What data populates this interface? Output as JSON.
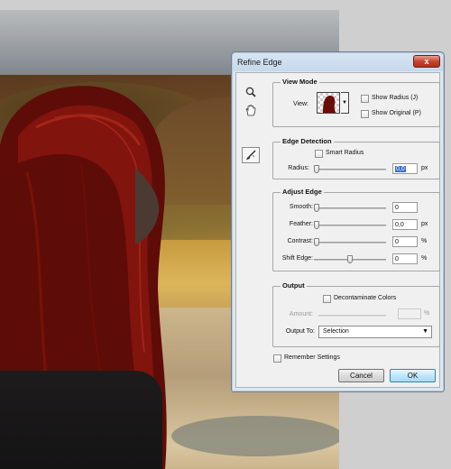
{
  "dialog": {
    "title": "Refine Edge",
    "close_symbol": "x",
    "tools": [
      "zoom-icon",
      "hand-icon",
      "refine-radius-brush-icon"
    ],
    "view_mode": {
      "heading": "View Mode",
      "view_label": "View:",
      "show_radius_label": "Show Radius (J)",
      "show_original_label": "Show Original (P)"
    },
    "edge_detection": {
      "heading": "Edge Detection",
      "smart_radius_label": "Smart Radius",
      "radius_label": "Radius:",
      "radius_value": "0,0",
      "radius_unit": "px"
    },
    "adjust_edge": {
      "heading": "Adjust Edge",
      "smooth_label": "Smooth:",
      "smooth_value": "0",
      "feather_label": "Feather:",
      "feather_value": "0,0",
      "feather_unit": "px",
      "contrast_label": "Contrast:",
      "contrast_value": "0",
      "contrast_unit": "%",
      "shift_edge_label": "Shift Edge:",
      "shift_edge_value": "0",
      "shift_edge_unit": "%"
    },
    "output": {
      "heading": "Output",
      "decontaminate_label": "Decontaminate Colors",
      "amount_label": "Amount:",
      "amount_value": "",
      "amount_unit": "%",
      "output_to_label": "Output To:",
      "output_to_value": "Selection",
      "dropdown_arrow": "▼"
    },
    "remember_settings_label": "Remember Settings",
    "cancel_label": "Cancel",
    "ok_label": "OK"
  }
}
